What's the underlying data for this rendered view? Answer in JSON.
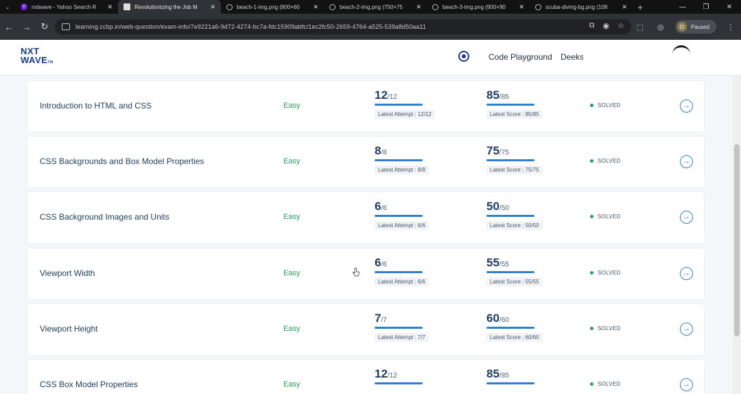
{
  "browser": {
    "tabs": [
      {
        "title": "nxtwave - Yahoo Search R",
        "icon": "yahoo-icon"
      },
      {
        "title": "Revolutionizing the Job M",
        "icon": "document-icon",
        "active": true
      },
      {
        "title": "beach-1-img.png (800×60",
        "icon": "globe-icon"
      },
      {
        "title": "beach-2-img.png (750×75",
        "icon": "globe-icon"
      },
      {
        "title": "beach-3-img.png (900×90",
        "icon": "globe-icon"
      },
      {
        "title": "scuba-diving-bg.png (108",
        "icon": "globe-icon"
      }
    ],
    "url": "learning.ccbp.in/web-question/exam-info/7e9221a6-9d72-4274-bc7a-fdc15909abfc/1ec2fc50-2659-4764-a525-539a8d50aa11",
    "profile_letter": "D",
    "profile_status": "Paused"
  },
  "header": {
    "logo_line1": "NXT",
    "logo_line2": "WAVE",
    "logo_tm": "TM",
    "link_playground": "Code Playground",
    "user_name": "Deeksha"
  },
  "rows": [
    {
      "title": "Introduction to HTML and CSS",
      "difficulty": "Easy",
      "attempt": "12",
      "attempt_total": "/12",
      "attempt_label": "Latest Attempt : 12/12",
      "score": "85",
      "score_total": "/85",
      "score_label": "Latest Score : 85/85",
      "status": "SOLVED"
    },
    {
      "title": "CSS Backgrounds and Box Model Properties",
      "difficulty": "Easy",
      "attempt": "8",
      "attempt_total": "/8",
      "attempt_label": "Latest Attempt : 8/8",
      "score": "75",
      "score_total": "/75",
      "score_label": "Latest Score : 75/75",
      "status": "SOLVED"
    },
    {
      "title": "CSS Background Images and Units",
      "difficulty": "Easy",
      "attempt": "6",
      "attempt_total": "/6",
      "attempt_label": "Latest Attempt : 6/6",
      "score": "50",
      "score_total": "/50",
      "score_label": "Latest Score : 50/50",
      "status": "SOLVED"
    },
    {
      "title": "Viewport Width",
      "difficulty": "Easy",
      "attempt": "6",
      "attempt_total": "/6",
      "attempt_label": "Latest Attempt : 6/6",
      "score": "55",
      "score_total": "/55",
      "score_label": "Latest Score : 55/55",
      "status": "SOLVED"
    },
    {
      "title": "Viewport Height",
      "difficulty": "Easy",
      "attempt": "7",
      "attempt_total": "/7",
      "attempt_label": "Latest Attempt : 7/7",
      "score": "60",
      "score_total": "/60",
      "score_label": "Latest Score : 60/60",
      "status": "SOLVED"
    },
    {
      "title": "CSS Box Model Properties",
      "difficulty": "Easy",
      "attempt": "12",
      "attempt_total": "/12",
      "attempt_label": "",
      "score": "85",
      "score_total": "/85",
      "score_label": "",
      "status": "SOLVED"
    }
  ],
  "colors": {
    "accent": "#2f7fd1",
    "easy": "#2a9d5c",
    "title": "#1f3a5f",
    "brand": "#173a8c"
  }
}
